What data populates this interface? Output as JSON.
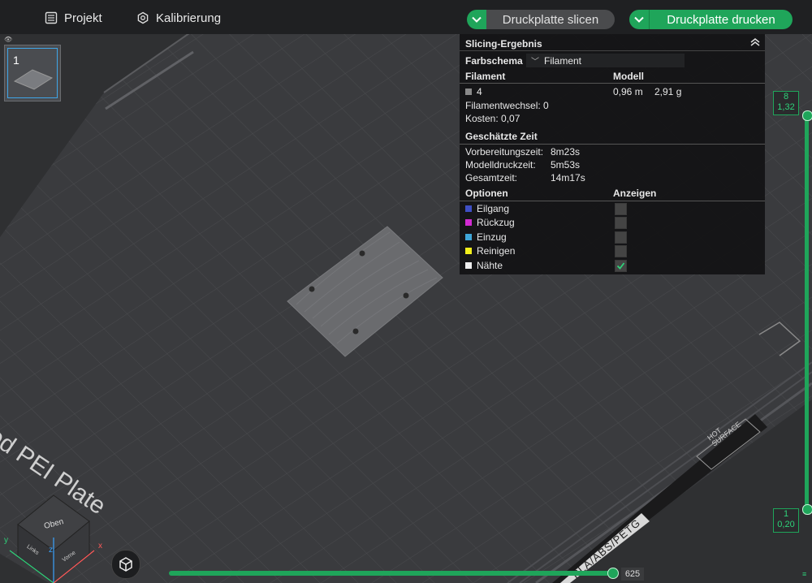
{
  "topbar": {
    "project_label": "Projekt",
    "calibration_label": "Kalibrierung",
    "slice_label": "Druckplatte slicen",
    "print_label": "Druckplatte drucken"
  },
  "plate": {
    "thumb_number": "1",
    "bed_text": "Textured PEI Plate",
    "hot_surface": "HOT SURFACE",
    "filament_text": "PLA/ABS/PETG"
  },
  "panel": {
    "title": "Slicing-Ergebnis",
    "color_scheme_label": "Farbschema",
    "color_scheme_value": "Filament",
    "filament_header": "Filament",
    "model_header": "Modell",
    "filament_id": "4",
    "model_length": "0,96 m",
    "model_weight": "2,91 g",
    "filament_changes": "Filamentwechsel: 0",
    "cost": "Kosten: 0,07",
    "time_header": "Geschätzte Zeit",
    "times": [
      {
        "label": "Vorbereitungszeit:",
        "value": "8m23s"
      },
      {
        "label": "Modelldruckzeit:",
        "value": "5m53s"
      },
      {
        "label": "Gesamtzeit:",
        "value": "14m17s"
      }
    ],
    "options_header": "Optionen",
    "show_header": "Anzeigen",
    "options": [
      {
        "label": "Eilgang",
        "color": "#3f4fc4",
        "checked": false
      },
      {
        "label": "Rückzug",
        "color": "#d22ad2",
        "checked": false
      },
      {
        "label": "Einzug",
        "color": "#3fa6d8",
        "checked": false
      },
      {
        "label": "Reinigen",
        "color": "#f2ef1c",
        "checked": false
      },
      {
        "label": "Nähte",
        "color": "#eeeeee",
        "checked": true
      }
    ]
  },
  "layer_slider": {
    "top_layer": "8",
    "top_height": "1,32",
    "bottom_layer": "1",
    "bottom_height": "0,20"
  },
  "move_slider": {
    "value": "625"
  },
  "view_cube": {
    "top": "Oben",
    "left": "Links",
    "front": "Vorne"
  },
  "colors": {
    "accent": "#1fa55a",
    "panel_bg": "#121213"
  }
}
